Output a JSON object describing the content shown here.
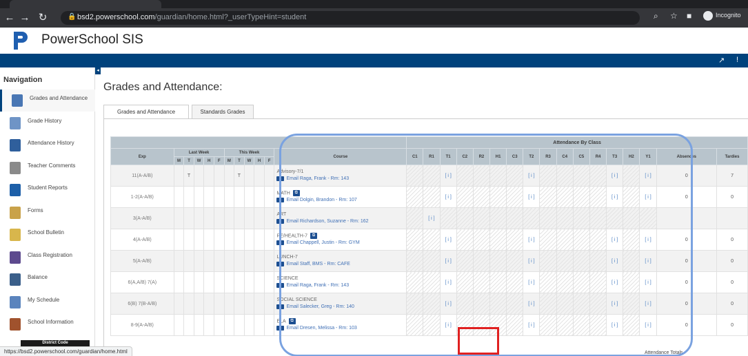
{
  "browser": {
    "url_host": "bsd2.powerschool.com",
    "url_path": "/guardian/home.html?_userTypeHint=student",
    "profile_label": "Incognito",
    "status_url": "https://bsd2.powerschool.com/guardian/home.html"
  },
  "header": {
    "app_title": "PowerSchool SIS",
    "brand_color": "#00427c"
  },
  "sidebar": {
    "heading": "Navigation",
    "items": [
      {
        "label": "Grades and Attendance",
        "icon": "grades-icon",
        "color": "#4a77b4",
        "active": true
      },
      {
        "label": "Grade History",
        "icon": "grade-history-icon",
        "color": "#6f94c6",
        "active": false
      },
      {
        "label": "Attendance History",
        "icon": "attendance-history-icon",
        "color": "#2f5f9c",
        "active": false
      },
      {
        "label": "Teacher Comments",
        "icon": "comments-icon",
        "color": "#8a8a8a",
        "active": false
      },
      {
        "label": "Student Reports",
        "icon": "reports-icon",
        "color": "#1d5fa8",
        "active": false
      },
      {
        "label": "Forms",
        "icon": "forms-icon",
        "color": "#c9a24a",
        "active": false
      },
      {
        "label": "School Bulletin",
        "icon": "bulletin-icon",
        "color": "#d8b64c",
        "active": false
      },
      {
        "label": "Class Registration",
        "icon": "registration-icon",
        "color": "#5d4a8e",
        "active": false
      },
      {
        "label": "Balance",
        "icon": "balance-icon",
        "color": "#3b5f8a",
        "active": false
      },
      {
        "label": "My Schedule",
        "icon": "schedule-icon",
        "color": "#5b84bd",
        "active": false
      },
      {
        "label": "School Information",
        "icon": "school-info-icon",
        "color": "#a0522d",
        "active": false
      }
    ],
    "district_code": "District Code"
  },
  "main": {
    "title": "Grades and Attendance:",
    "tabs": [
      {
        "label": "Grades and Attendance",
        "active": true
      },
      {
        "label": "Standards Grades",
        "active": false
      }
    ]
  },
  "table": {
    "group_header": "Attendance By Class",
    "col_exp": "Exp",
    "col_last_week": "Last Week",
    "col_this_week": "This Week",
    "days": [
      "M",
      "T",
      "W",
      "H",
      "F"
    ],
    "col_course": "Course",
    "terms": [
      "C1",
      "R1",
      "T1",
      "C2",
      "R2",
      "H1",
      "C3",
      "T2",
      "R3",
      "C4",
      "C5",
      "R4",
      "T3",
      "H2",
      "Y1"
    ],
    "col_absences": "Absences",
    "col_tardies": "Tardies",
    "grade_placeholder": "[ i ]",
    "rows": [
      {
        "exp": "11(A-A/B)",
        "last": [
          "",
          "T",
          "",
          "",
          ""
        ],
        "this": [
          "",
          "T",
          "",
          "",
          ""
        ],
        "course": "Advisory-7/1",
        "has_doc": false,
        "teacher": "Email Raga, Frank - Rm: 143",
        "grades": [
          0,
          0,
          1,
          0,
          0,
          0,
          0,
          1,
          0,
          0,
          0,
          0,
          1,
          0,
          1
        ],
        "absences": "0",
        "tardies": "7"
      },
      {
        "exp": "1-2(A-A/B)",
        "last": [
          "",
          "",
          "",
          "",
          ""
        ],
        "this": [
          "",
          "",
          "",
          "",
          ""
        ],
        "course": "MATH",
        "has_doc": true,
        "teacher": "Email Dolgin, Brandon - Rm: 107",
        "grades": [
          0,
          0,
          1,
          0,
          0,
          0,
          0,
          1,
          0,
          0,
          0,
          0,
          1,
          0,
          1
        ],
        "absences": "0",
        "tardies": "0"
      },
      {
        "exp": "3(A-A/B)",
        "last": [
          "",
          "",
          "",
          "",
          ""
        ],
        "this": [
          "",
          "",
          "",
          "",
          ""
        ],
        "course": "ART",
        "has_doc": false,
        "teacher": "Email Richardson, Suzanne - Rm: 162",
        "grades": [
          0,
          1,
          0,
          0,
          0,
          0,
          0,
          0,
          0,
          0,
          0,
          0,
          0,
          0,
          0
        ],
        "absences": "",
        "tardies": ""
      },
      {
        "exp": "4(A-A/B)",
        "last": [
          "",
          "",
          "",
          "",
          ""
        ],
        "this": [
          "",
          "",
          "",
          "",
          ""
        ],
        "course": "PE/HEALTH-7",
        "has_doc": true,
        "teacher": "Email Chappell, Justin - Rm: GYM",
        "grades": [
          0,
          0,
          1,
          0,
          0,
          0,
          0,
          1,
          0,
          0,
          0,
          0,
          1,
          0,
          1
        ],
        "absences": "0",
        "tardies": "0"
      },
      {
        "exp": "5(A-A/B)",
        "last": [
          "",
          "",
          "",
          "",
          ""
        ],
        "this": [
          "",
          "",
          "",
          "",
          ""
        ],
        "course": "LUNCH-7",
        "has_doc": false,
        "teacher": "Email Staff, BMS - Rm: CAFE",
        "grades": [
          0,
          0,
          1,
          0,
          0,
          0,
          0,
          1,
          0,
          0,
          0,
          0,
          1,
          0,
          1
        ],
        "absences": "0",
        "tardies": "0"
      },
      {
        "exp": "6(A,A/B) 7(A)",
        "last": [
          "",
          "",
          "",
          "",
          ""
        ],
        "this": [
          "",
          "",
          "",
          "",
          ""
        ],
        "course": "SCIENCE",
        "has_doc": false,
        "teacher": "Email Raga, Frank - Rm: 143",
        "grades": [
          0,
          0,
          1,
          0,
          0,
          0,
          0,
          1,
          0,
          0,
          0,
          0,
          1,
          0,
          1
        ],
        "absences": "0",
        "tardies": "0"
      },
      {
        "exp": "6(B) 7(B-A/B)",
        "last": [
          "",
          "",
          "",
          "",
          ""
        ],
        "this": [
          "",
          "",
          "",
          "",
          ""
        ],
        "course": "SOCIAL SCIENCE",
        "has_doc": false,
        "teacher": "Email Salecker, Greg - Rm: 140",
        "grades": [
          0,
          0,
          1,
          0,
          0,
          0,
          0,
          1,
          0,
          0,
          0,
          0,
          1,
          0,
          1
        ],
        "absences": "0",
        "tardies": "0"
      },
      {
        "exp": "8-9(A-A/B)",
        "last": [
          "",
          "",
          "",
          "",
          ""
        ],
        "this": [
          "",
          "",
          "",
          "",
          ""
        ],
        "course": "ELA",
        "has_doc": true,
        "teacher": "Email Dresen, Melissa - Rm: 103",
        "grades": [
          0,
          0,
          1,
          0,
          0,
          0,
          0,
          1,
          0,
          0,
          0,
          0,
          1,
          0,
          1
        ],
        "absences": "0",
        "tardies": "0"
      }
    ],
    "totals_label": "Attendance Totals"
  },
  "overlay": {
    "outline_color": "#7aa2e0",
    "highlight_color": "#e02020"
  }
}
